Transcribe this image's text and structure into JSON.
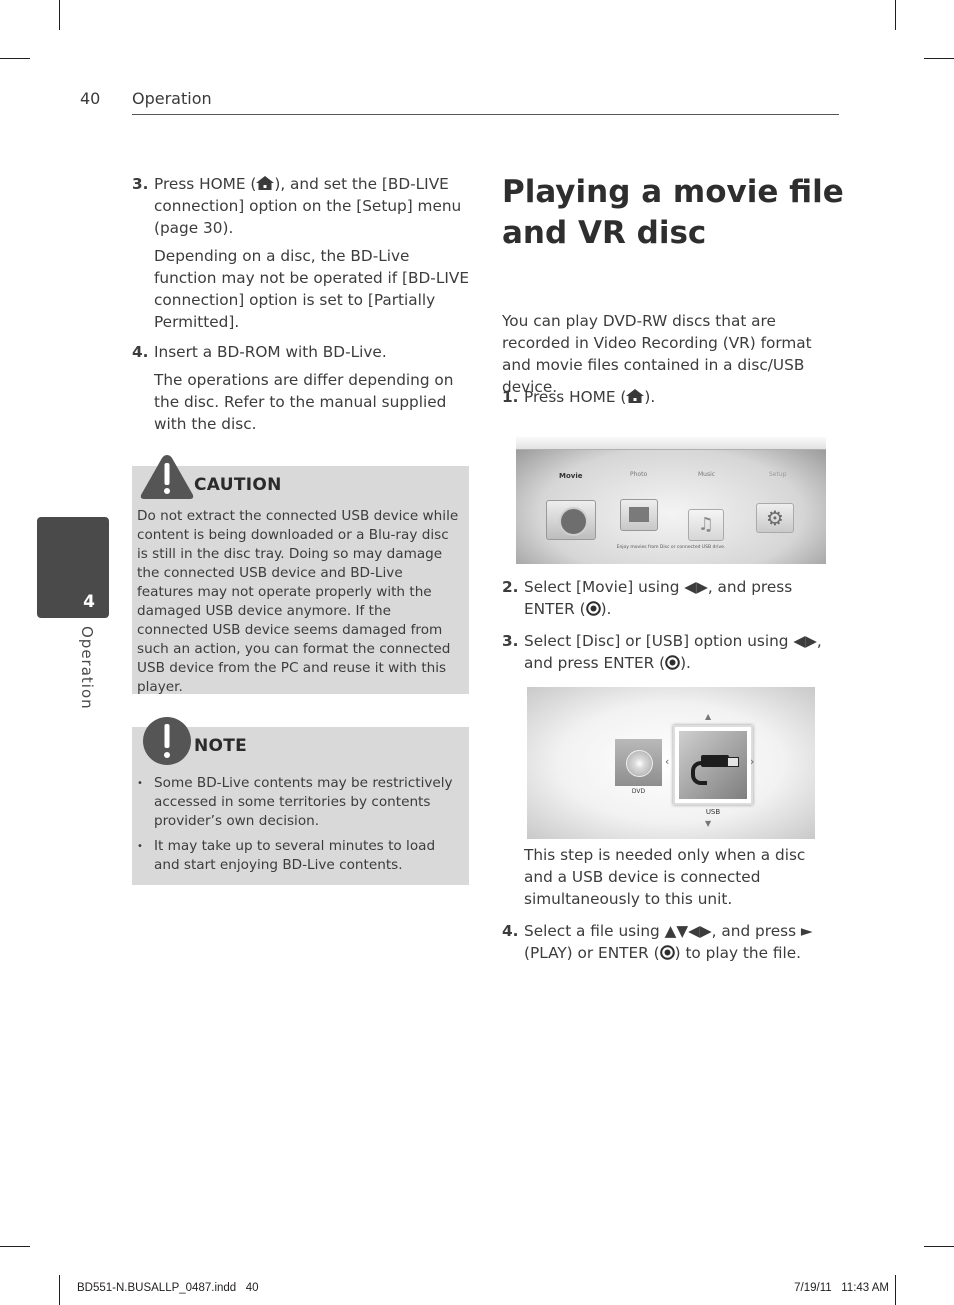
{
  "header": {
    "page_number": "40",
    "section": "Operation"
  },
  "side_tab": {
    "chapter_number": "4",
    "chapter_label": "Operation"
  },
  "left_column": {
    "steps": [
      {
        "number": "3.",
        "text_before_icon": "Press HOME (",
        "text_after_icon": "), and set the [BD-LIVE connection] option on the [Setup] menu (page 30).",
        "note": "Depending on a disc, the BD-Live function may not be operated if [BD-LIVE connection] option is set to [Partially Permitted]."
      },
      {
        "number": "4.",
        "text": "Insert a BD-ROM with BD-Live.",
        "note": "The operations are differ depending on the disc. Refer to the manual supplied with the disc."
      }
    ],
    "caution": {
      "title": "CAUTION",
      "icon": "warning-triangle-icon",
      "text": "Do not extract the connected USB device while content is being downloaded or a Blu-ray disc is still in the disc tray. Doing so may damage the connected USB device and BD-Live features may not operate properly with the damaged USB device anymore. If the connected USB device seems damaged from such an action, you can format the connected USB device from the PC and reuse it with this player."
    },
    "note": {
      "title": "NOTE",
      "icon": "exclamation-circle-icon",
      "items": [
        "Some BD-Live contents may be restrictively accessed in some territories by contents provider’s own decision.",
        "It may take up to several minutes to load and start enjoying BD-Live contents."
      ]
    }
  },
  "right_column": {
    "title_line1": "Playing a movie file",
    "title_line2": "and VR disc",
    "intro": "You can play DVD-RW discs that are recorded in Video Recording (VR) format and movie files contained in a disc/USB device.",
    "steps": [
      {
        "number": "1.",
        "text_before_icon": "Press HOME (",
        "text_after_icon": ")."
      },
      {
        "number": "2.",
        "text_before_icon": "Select [Movie] using  ◀▶, and press ENTER (",
        "text_after_icon": ")."
      },
      {
        "number": "3.",
        "text_before_icon": "Select [Disc] or [USB] option using  ◀▶, and press ENTER (",
        "text_after_icon": ").",
        "note": "This step is needed only when a disc and a USB device is connected simultaneously to this unit."
      },
      {
        "number": "4.",
        "text_before_icon": "Select a file using ▲▼◀▶, and press ► (PLAY) or ENTER (",
        "text_after_icon": ") to play the file."
      }
    ],
    "home_menu_screen": {
      "tabs": [
        "Movie",
        "Photo",
        "Music",
        "Setup"
      ],
      "selected_tab": "Movie",
      "hint": "Enjoy movies from Disc or connected USB drive."
    },
    "device_select_screen": {
      "devices": [
        "DVD",
        "USB"
      ],
      "selected_device": "USB"
    }
  },
  "footer": {
    "file_info": "BD551-N.BUSALLP_0487.indd   40",
    "timestamp": "7/19/11   11:43 AM"
  }
}
